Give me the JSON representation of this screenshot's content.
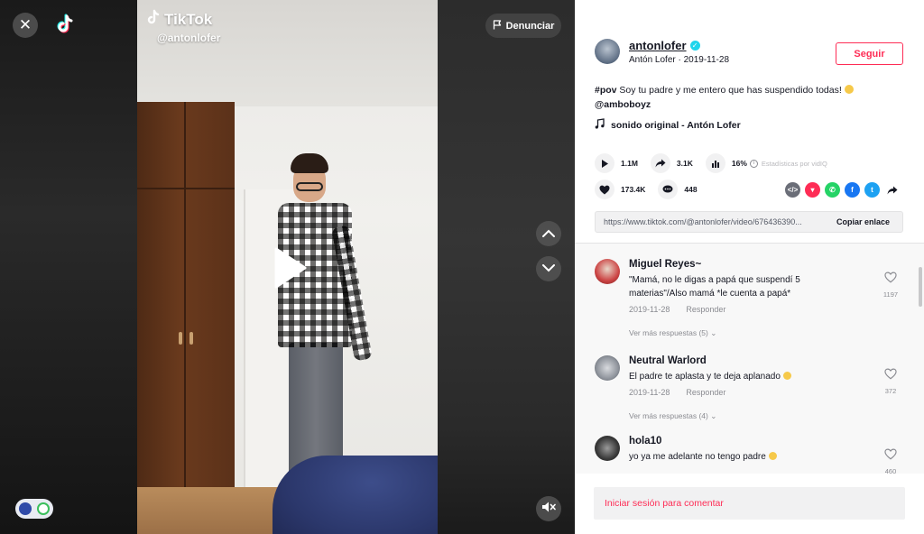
{
  "stage": {
    "watermark_brand": "TikTok",
    "watermark_handle": "@antonlofer",
    "report_label": "Denunciar"
  },
  "author": {
    "username": "antonlofer",
    "subline": "Antón Lofer · 2019-11-28",
    "follow_label": "Seguir"
  },
  "caption": {
    "hashtag": "#pov",
    "text": " Soy tu padre y me entero que has suspendido todas! ",
    "mention": "@amboboyz"
  },
  "sound": {
    "label": "sonido original - Antón Lofer"
  },
  "stats": {
    "plays": "1.1M",
    "shares": "3.1K",
    "percent": "16%",
    "percent_note": "Estadísticas por vidIQ",
    "likes": "173.4K",
    "comments": "448"
  },
  "share": {
    "url": "https://www.tiktok.com/@antonlofer/video/676436390...",
    "copy_label": "Copiar enlace",
    "icons": [
      "embed-icon",
      "tiktok-share-icon",
      "whatsapp-icon",
      "facebook-icon",
      "twitter-icon",
      "more-share-icon"
    ]
  },
  "comments": [
    {
      "name": "Miguel Reyes~",
      "text": "\"Mamá, no le digas a papá que suspendí 5 materias\"/Also mamá *le cuenta a papá*",
      "date": "2019-11-28",
      "reply_label": "Responder",
      "likes": "1197",
      "more_label": "Ver más respuestas (5)"
    },
    {
      "name": "Neutral Warlord",
      "text": "El padre te aplasta y te deja aplanado ",
      "date": "2019-11-28",
      "reply_label": "Responder",
      "likes": "372",
      "more_label": "Ver más respuestas (4)"
    },
    {
      "name": "hola10",
      "text": "yo ya me adelante no tengo padre ",
      "likes": "460"
    }
  ],
  "login": {
    "label": "Iniciar sesión para comentar"
  },
  "colors": {
    "accent": "#fe2c55",
    "text": "#161823",
    "muted": "#8a8b91",
    "verified": "#20d5ec"
  }
}
